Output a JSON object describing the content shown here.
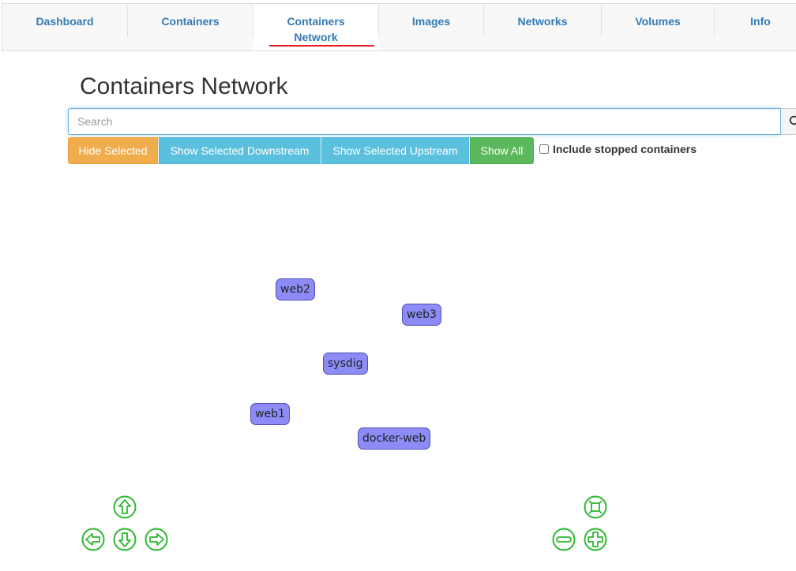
{
  "nav": {
    "items": [
      {
        "label": "Dashboard"
      },
      {
        "label": "Containers"
      },
      {
        "label_line1": "Containers",
        "label_line2": "Network"
      },
      {
        "label": "Images"
      },
      {
        "label": "Networks"
      },
      {
        "label": "Volumes"
      },
      {
        "label": "Info"
      }
    ],
    "active_index": 2,
    "active_underline_color": "#e51c23"
  },
  "page": {
    "title": "Containers Network"
  },
  "search": {
    "placeholder": "Search",
    "value": "",
    "icon": "search-icon"
  },
  "buttons": {
    "hide_selected": "Hide Selected",
    "show_downstream": "Show Selected Downstream",
    "show_upstream": "Show Selected Upstream",
    "show_all": "Show All"
  },
  "include_stopped": {
    "label": "Include stopped containers",
    "checked": false
  },
  "graph": {
    "node_color": "#8d8cf7",
    "nodes": [
      {
        "label": "web2"
      },
      {
        "label": "web3"
      },
      {
        "label": "sysdig"
      },
      {
        "label": "web1"
      },
      {
        "label": "docker-web"
      }
    ]
  },
  "controls": {
    "color": "#2db82d",
    "icons": [
      "arrow-up-icon",
      "arrow-left-icon",
      "arrow-down-icon",
      "arrow-right-icon",
      "zoom-fit-icon",
      "zoom-out-icon",
      "zoom-in-icon"
    ]
  }
}
